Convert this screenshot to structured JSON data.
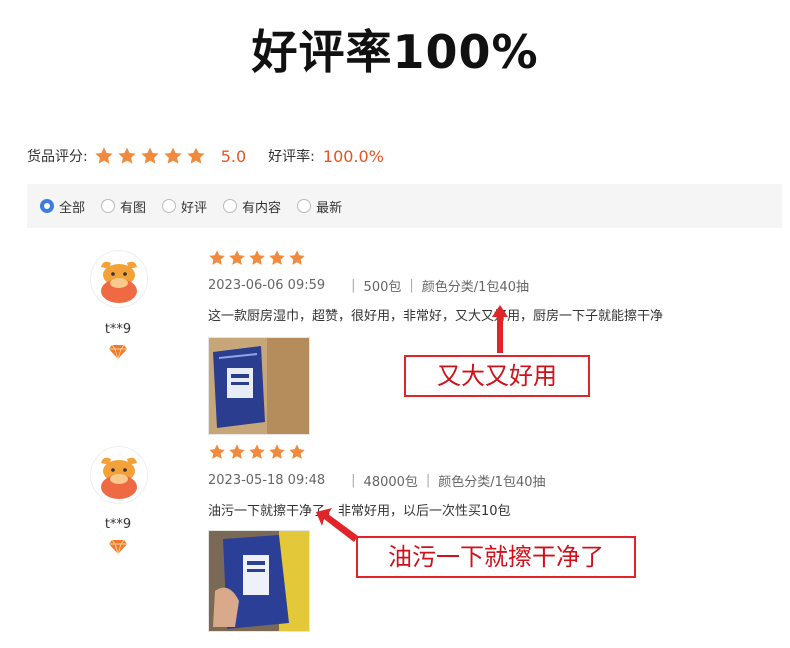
{
  "headline": "好评率100%",
  "summary": {
    "goods_rating_label": "货品评分:",
    "score": "5.0",
    "positive_rate_label": "好评率:",
    "positive_rate": "100.0%",
    "stars": 5
  },
  "filters": [
    {
      "label": "全部",
      "selected": true
    },
    {
      "label": "有图",
      "selected": false
    },
    {
      "label": "好评",
      "selected": false
    },
    {
      "label": "有内容",
      "selected": false
    },
    {
      "label": "最新",
      "selected": false
    }
  ],
  "reviews": [
    {
      "username": "t**9",
      "stars": 5,
      "date": "2023-06-06 09:59",
      "quantity": "500包",
      "variant": "颜色分类/1包40抽",
      "text": "这一款厨房湿巾，超赞，很好用，非常好，又大又好用，厨房一下子就能擦干净",
      "callout": "又大又好用"
    },
    {
      "username": "t**9",
      "stars": 5,
      "date": "2023-05-18 09:48",
      "quantity": "48000包",
      "variant": "颜色分类/1包40抽",
      "text": "油污一下就擦干净了，非常好用，以后一次性买10包",
      "callout": "油污一下就擦干净了"
    }
  ],
  "colors": {
    "accent_orange": "#f08a3c",
    "score_red": "#e8541e",
    "callout_red": "#e0242a",
    "radio_blue": "#3b7ddd"
  }
}
